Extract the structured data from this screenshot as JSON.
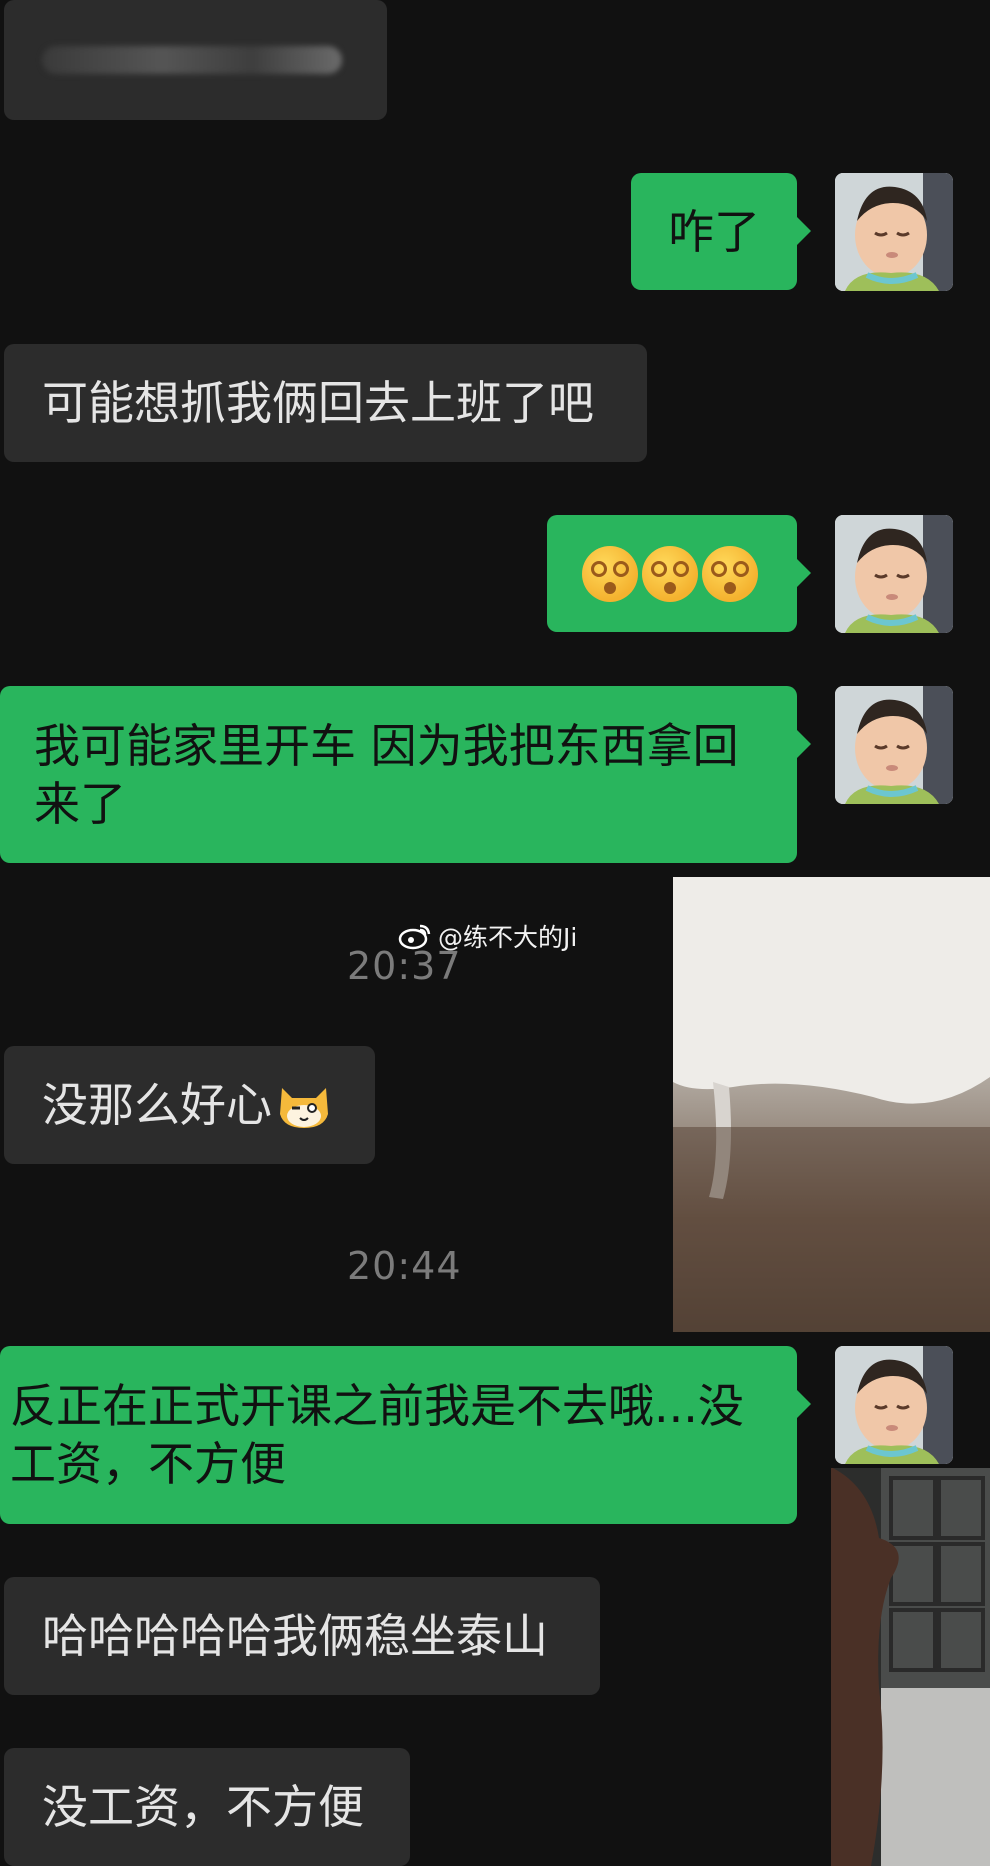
{
  "messages": {
    "m1": {
      "text": ""
    },
    "m2": {
      "text": "咋了"
    },
    "m3": {
      "text": "可能想抓我俩回去上班了吧"
    },
    "m4": {
      "emoji_count": 3,
      "emoji_name": "dizzy-face-emoji"
    },
    "m5": {
      "text": "我可能家里开车 因为我把东西拿回来了"
    },
    "m6": {
      "text": "没那么好心",
      "emoji_name": "cat-face-emoji"
    },
    "m7": {
      "text": "反正在正式开课之前我是不去哦...没工资，不方便"
    },
    "m8": {
      "text": "哈哈哈哈哈我俩稳坐泰山"
    },
    "m9": {
      "text": "没工资，不方便"
    }
  },
  "timestamps": {
    "t1": "20:37",
    "t2": "20:44"
  },
  "watermark": {
    "text": "@练不大的Ji",
    "icon": "weibo-icon"
  },
  "colors": {
    "background": "#111111",
    "incoming_bubble": "#2c2c2c",
    "outgoing_bubble": "#29b55d",
    "incoming_text": "#e5e5e5",
    "outgoing_text": "#111111",
    "timestamp": "#7b7b7b"
  }
}
